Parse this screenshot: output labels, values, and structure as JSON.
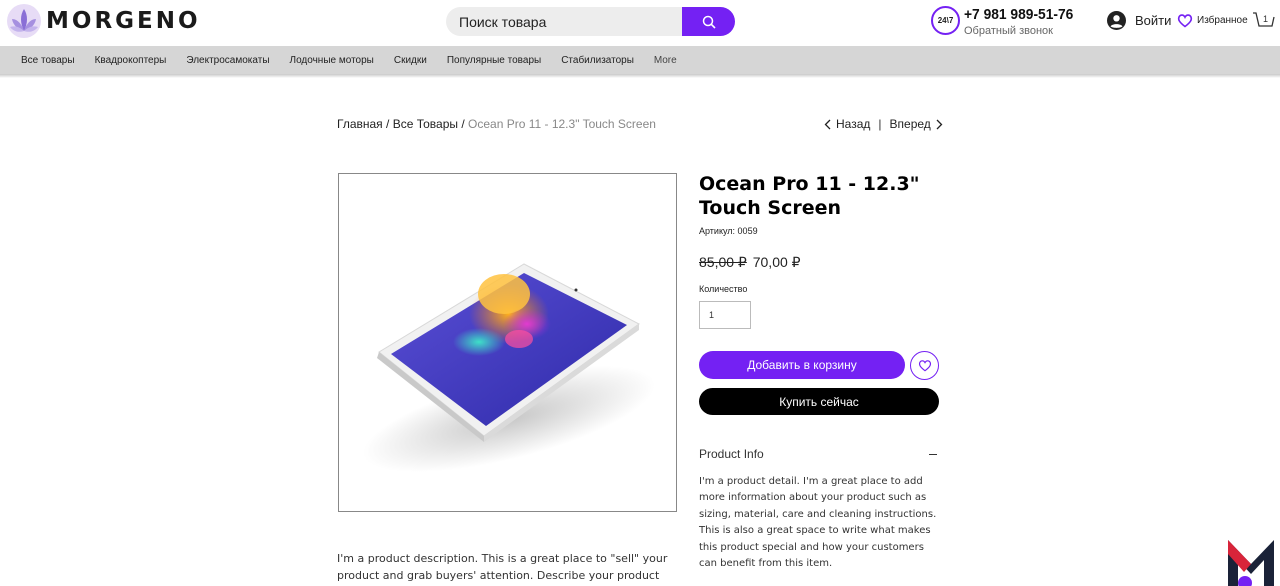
{
  "header": {
    "logo_text": "MORGENO",
    "search_placeholder": "Поиск товара",
    "badge": "24\\7",
    "phone": "+7 981 989-51-76",
    "callback": "Обратный звонок",
    "login": "Войти",
    "favorites": "Избранное",
    "cart_count": "1"
  },
  "nav": {
    "items": [
      "Все товары",
      "Квадрокоптеры",
      "Электросамокаты",
      "Лодочные моторы",
      "Скидки",
      "Популярные товары",
      "Стабилизаторы",
      "More"
    ]
  },
  "breadcrumb": {
    "home": "Главная",
    "sep": " / ",
    "all": "Все Товары",
    "current": "Ocean Pro 11 - 12.3\" Touch Screen"
  },
  "pager": {
    "prev": "Назад",
    "divider": "|",
    "next": "Вперед"
  },
  "product": {
    "title": "Ocean Pro 11 - 12.3\" Touch Screen",
    "sku": "Артикул: 0059",
    "old_price": "85,00 ₽",
    "price": "70,00 ₽",
    "qty_label": "Количество",
    "qty_value": "1",
    "add_to_cart": "Добавить в корзину",
    "buy_now": "Купить сейчас",
    "info_title": "Product Info",
    "info_text": "I'm a product detail. I'm a great place to add more information about your product such as sizing, material, care and cleaning instructions. This is also a great space to write what makes this product special and how your customers can benefit from this item.",
    "description": "I'm a product description. This is a great place to \"sell\" your product and grab buyers' attention. Describe your product clearly"
  },
  "colors": {
    "accent": "#7421f3",
    "nav_bg": "#d6d6d6",
    "buy_bg": "#000000"
  }
}
